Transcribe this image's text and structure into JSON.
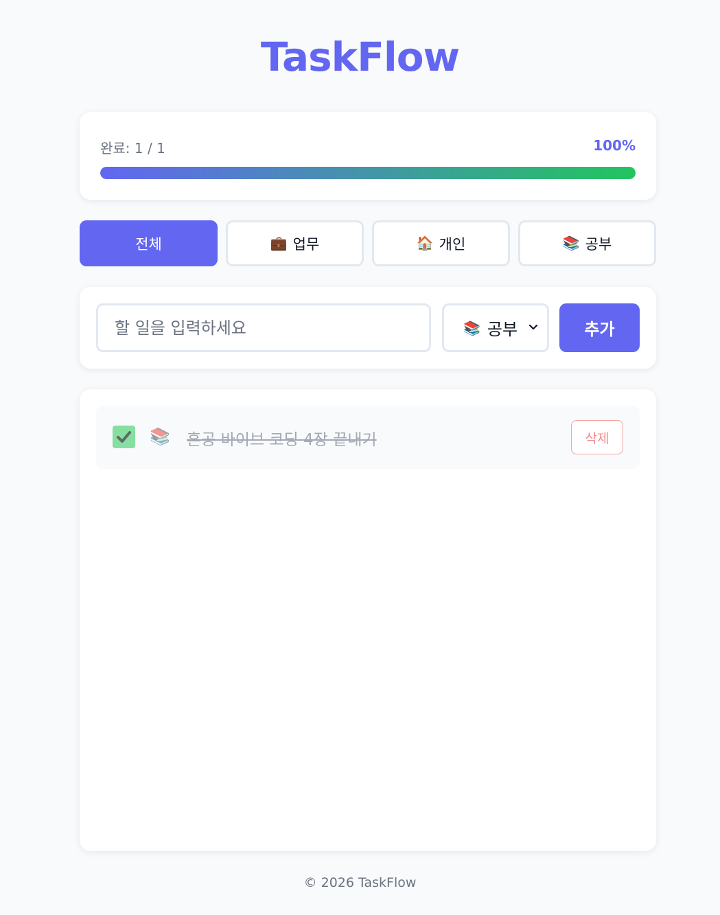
{
  "header": {
    "title": "TaskFlow"
  },
  "progress": {
    "label": "완료: 1 / 1",
    "percent_text": "100%",
    "fraction": 1.0
  },
  "filters": [
    {
      "icon": "",
      "icon_name": "",
      "label": "전체",
      "active": true
    },
    {
      "icon": "💼",
      "icon_name": "briefcase-icon",
      "label": "업무",
      "active": false
    },
    {
      "icon": "🏠",
      "icon_name": "house-icon",
      "label": "개인",
      "active": false
    },
    {
      "icon": "📚",
      "icon_name": "books-icon",
      "label": "공부",
      "active": false
    }
  ],
  "input": {
    "placeholder": "할 일을 입력하세요",
    "value": ""
  },
  "category_select": {
    "icon": "📚",
    "icon_name": "books-icon",
    "selected": "공부"
  },
  "add_button": {
    "label": "추가"
  },
  "tasks": [
    {
      "done": true,
      "category_icon": "📚",
      "category_icon_name": "books-icon",
      "text": "혼공 바이브 코딩 4장 끝내기",
      "delete_label": "삭제"
    }
  ],
  "footer": {
    "text": "© 2026 TaskFlow"
  },
  "colors": {
    "accent": "#6366f1",
    "success": "#22c55e",
    "danger": "#f28b8b"
  }
}
